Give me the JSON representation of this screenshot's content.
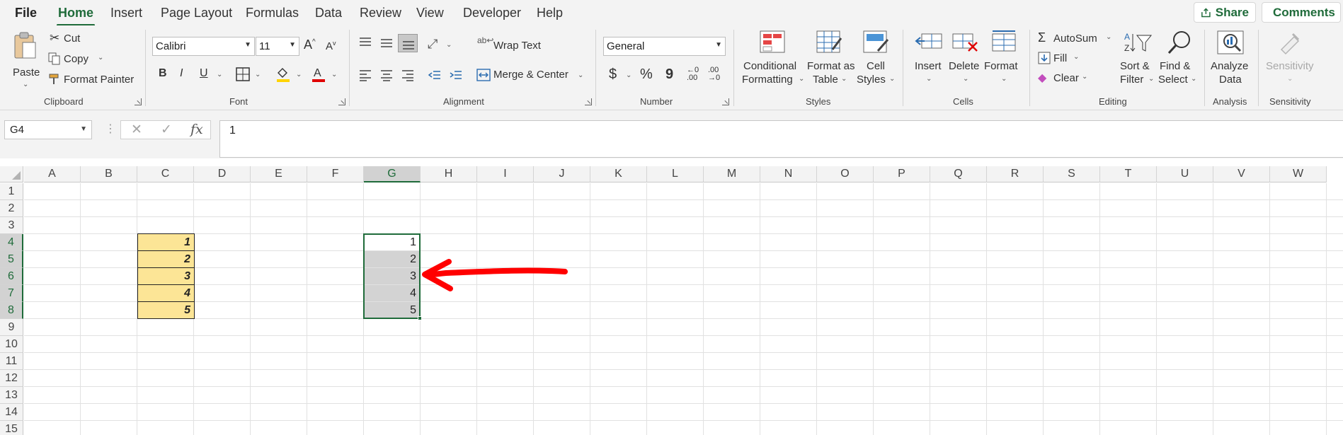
{
  "tabs": [
    "File",
    "Home",
    "Insert",
    "Page Layout",
    "Formulas",
    "Data",
    "Review",
    "View",
    "Developer",
    "Help"
  ],
  "active_tab": "Home",
  "top_buttons": {
    "share": "Share",
    "comments": "Comments"
  },
  "ribbon": {
    "clipboard": {
      "paste": "Paste",
      "cut": "Cut",
      "copy": "Copy",
      "format_painter": "Format Painter",
      "label": "Clipboard"
    },
    "font": {
      "name": "Calibri",
      "size": "11",
      "bold": "B",
      "italic": "I",
      "underline": "U",
      "label": "Font"
    },
    "alignment": {
      "wrap_text": "Wrap Text",
      "merge_center": "Merge & Center",
      "label": "Alignment"
    },
    "number": {
      "format": "General",
      "currency": "$",
      "percent": "%",
      "comma": "9",
      "inc_decimal": "←0 .00",
      "dec_decimal": ".00 →0",
      "label": "Number"
    },
    "styles": {
      "conditional_1": "Conditional",
      "conditional_2": "Formatting",
      "format_table_1": "Format as",
      "format_table_2": "Table",
      "cell_styles_1": "Cell",
      "cell_styles_2": "Styles",
      "label": "Styles"
    },
    "cells": {
      "insert": "Insert",
      "delete": "Delete",
      "format": "Format",
      "label": "Cells"
    },
    "editing": {
      "autosum": "AutoSum",
      "fill": "Fill",
      "clear": "Clear",
      "sort_1": "Sort &",
      "sort_2": "Filter",
      "find_1": "Find &",
      "find_2": "Select",
      "label": "Editing"
    },
    "analysis": {
      "analyze_1": "Analyze",
      "analyze_2": "Data",
      "label": "Analysis"
    },
    "sensitivity": {
      "button": "Sensitivity",
      "label": "Sensitivity"
    }
  },
  "formula_bar": {
    "name_box": "G4",
    "cancel": "✕",
    "enter": "✓",
    "fx": "fx",
    "value": "1"
  },
  "grid": {
    "columns": [
      "A",
      "B",
      "C",
      "D",
      "E",
      "F",
      "G",
      "H",
      "I",
      "J",
      "K",
      "L",
      "M",
      "N",
      "O",
      "P",
      "Q",
      "R",
      "S",
      "T",
      "U",
      "V",
      "W"
    ],
    "rows": [
      "1",
      "2",
      "3",
      "4",
      "5",
      "6",
      "7",
      "8",
      "9",
      "10",
      "11",
      "12",
      "13",
      "14",
      "15"
    ],
    "selected_column": "G",
    "selected_rows": [
      "4",
      "5",
      "6",
      "7",
      "8"
    ],
    "column_c_values": [
      "1",
      "2",
      "3",
      "4",
      "5"
    ],
    "column_g_values": [
      "1",
      "2",
      "3",
      "4",
      "5"
    ]
  },
  "annotation": {
    "color": "#ff0000"
  },
  "colors": {
    "accent": "#1f6b3a",
    "yellow_fill": "#fce596",
    "selection_fill": "#d3d3d3"
  }
}
